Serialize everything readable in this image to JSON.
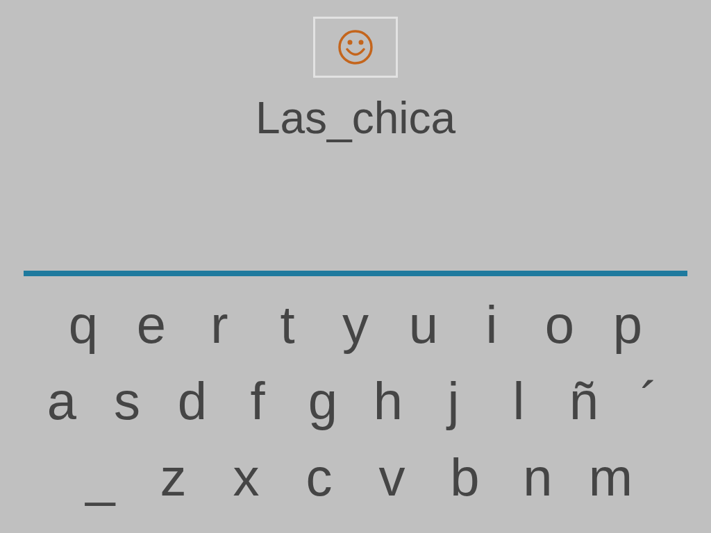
{
  "word": "Las_chica",
  "keyboard_rows": [
    [
      "q",
      "e",
      "r",
      "t",
      "y",
      "u",
      "i",
      "o",
      "p"
    ],
    [
      "a",
      "s",
      "d",
      "f",
      "g",
      "h",
      "j",
      "l",
      "ñ",
      "´"
    ],
    [
      "_",
      "z",
      "x",
      "c",
      "v",
      "b",
      "n",
      "m"
    ]
  ]
}
